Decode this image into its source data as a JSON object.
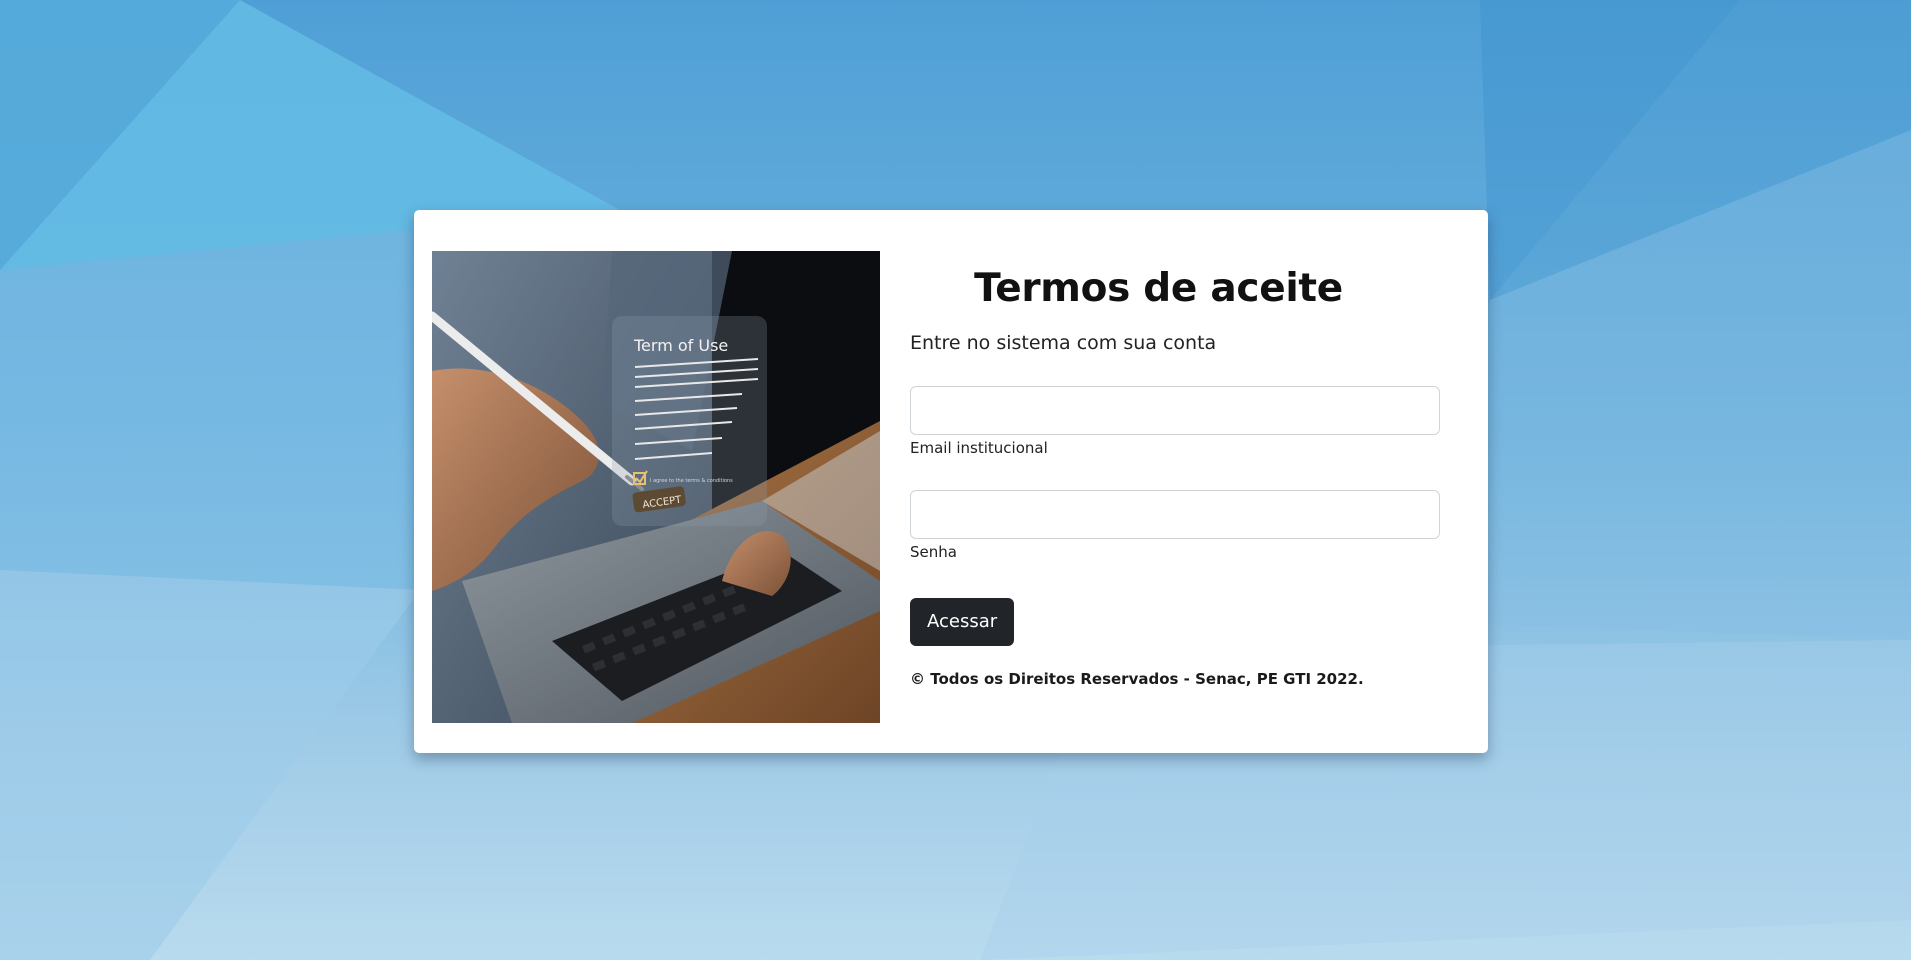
{
  "form": {
    "title": "Termos de aceite",
    "subtitle": "Entre no sistema com sua conta",
    "email": {
      "label": "Email institucional",
      "value": "",
      "placeholder": ""
    },
    "password": {
      "label": "Senha",
      "value": "",
      "placeholder": ""
    },
    "submit_label": "Acessar",
    "footer": "© Todos os Direitos Reservados - Senac, PE GTI 2022."
  },
  "illustration": {
    "heading": "Term of Use",
    "checkbox_text": "I agree to the terms & conditions",
    "accept_label": "ACCEPT"
  },
  "colors": {
    "background": "#5aa6da",
    "card": "#ffffff",
    "button": "#212529",
    "button_text": "#ffffff"
  }
}
